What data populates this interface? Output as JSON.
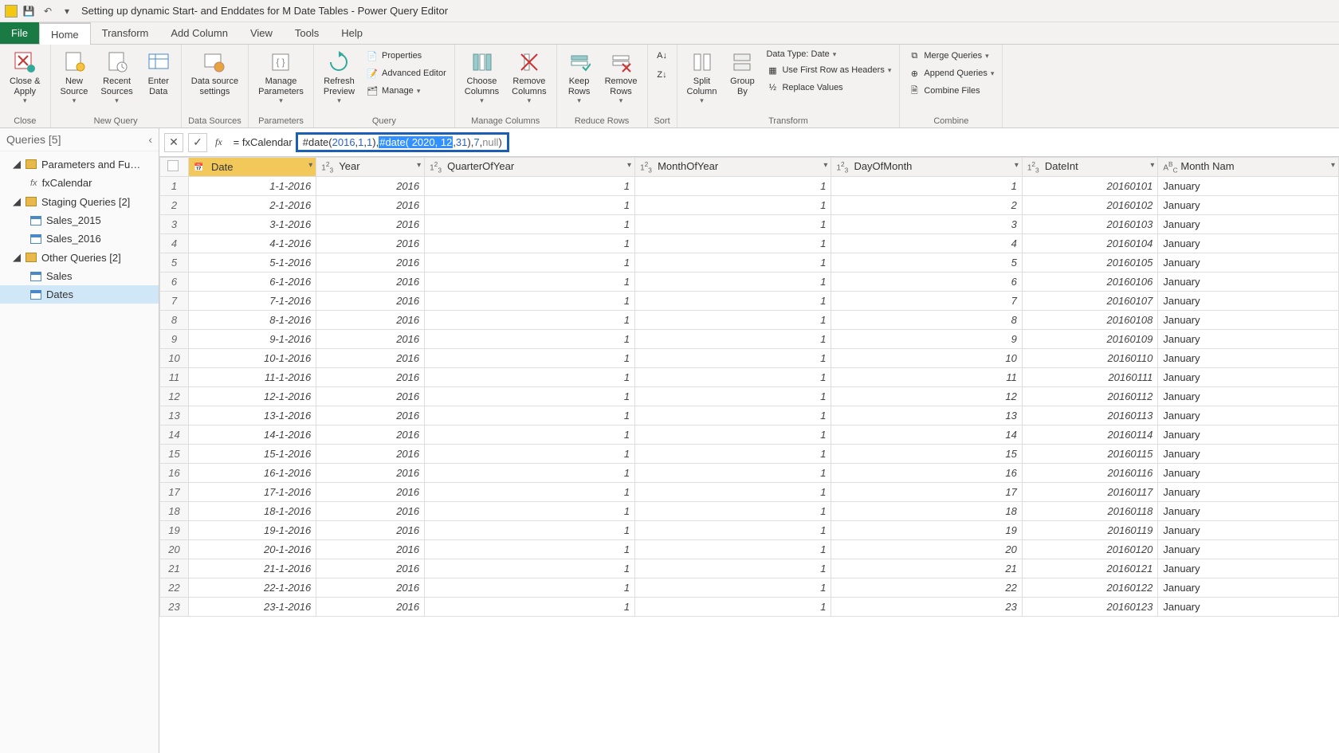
{
  "window": {
    "title": "Setting up dynamic Start- and Enddates for M Date Tables - Power Query Editor"
  },
  "tabs": {
    "file": "File",
    "home": "Home",
    "transform": "Transform",
    "add_column": "Add Column",
    "view": "View",
    "tools": "Tools",
    "help": "Help"
  },
  "ribbon": {
    "close_apply": "Close &\nApply",
    "close_group": "Close",
    "new_source": "New\nSource",
    "recent_sources": "Recent\nSources",
    "enter_data": "Enter\nData",
    "new_query_group": "New Query",
    "data_source_settings": "Data source\nsettings",
    "data_sources_group": "Data Sources",
    "manage_parameters": "Manage\nParameters",
    "parameters_group": "Parameters",
    "refresh_preview": "Refresh\nPreview",
    "properties": "Properties",
    "advanced_editor": "Advanced Editor",
    "manage": "Manage",
    "query_group": "Query",
    "choose_columns": "Choose\nColumns",
    "remove_columns": "Remove\nColumns",
    "manage_columns_group": "Manage Columns",
    "keep_rows": "Keep\nRows",
    "remove_rows": "Remove\nRows",
    "reduce_rows_group": "Reduce Rows",
    "sort_group": "Sort",
    "split_column": "Split\nColumn",
    "group_by": "Group\nBy",
    "data_type": "Data Type: Date",
    "use_first_row": "Use First Row as Headers",
    "replace_values": "Replace Values",
    "transform_group": "Transform",
    "merge_queries": "Merge Queries",
    "append_queries": "Append Queries",
    "combine_files": "Combine Files",
    "combine_group": "Combine"
  },
  "queries": {
    "header": "Queries [5]",
    "groups": [
      {
        "label": "Parameters and Fu…",
        "items": [
          {
            "type": "fx",
            "label": "fxCalendar"
          }
        ]
      },
      {
        "label": "Staging Queries [2]",
        "items": [
          {
            "type": "tbl",
            "label": "Sales_2015"
          },
          {
            "type": "tbl",
            "label": "Sales_2016"
          }
        ]
      },
      {
        "label": "Other Queries [2]",
        "items": [
          {
            "type": "tbl",
            "label": "Sales"
          },
          {
            "type": "tbl",
            "label": "Dates",
            "selected": true
          }
        ]
      }
    ]
  },
  "formula": {
    "prefix": "= fxCalendar",
    "segments": [
      {
        "t": "txt",
        "v": "#date( "
      },
      {
        "t": "num",
        "v": "2016"
      },
      {
        "t": "txt",
        "v": ", "
      },
      {
        "t": "num",
        "v": "1"
      },
      {
        "t": "txt",
        "v": ", "
      },
      {
        "t": "num",
        "v": "1"
      },
      {
        "t": "txt",
        "v": "), "
      },
      {
        "t": "sel",
        "v": "#date( 2020, 12"
      },
      {
        "t": "txt",
        "v": ", "
      },
      {
        "t": "num",
        "v": "31"
      },
      {
        "t": "txt",
        "v": "), "
      },
      {
        "t": "num",
        "v": "7"
      },
      {
        "t": "txt",
        "v": ", "
      },
      {
        "t": "null",
        "v": "null"
      },
      {
        "t": "txt",
        "v": ")"
      }
    ]
  },
  "columns": [
    {
      "name": "Date",
      "type": "date",
      "selected": true
    },
    {
      "name": "Year",
      "type": "num"
    },
    {
      "name": "QuarterOfYear",
      "type": "num"
    },
    {
      "name": "MonthOfYear",
      "type": "num"
    },
    {
      "name": "DayOfMonth",
      "type": "num"
    },
    {
      "name": "DateInt",
      "type": "num"
    },
    {
      "name": "Month Nam",
      "type": "text"
    }
  ],
  "rows": [
    {
      "n": 1,
      "Date": "1-1-2016",
      "Year": "2016",
      "QuarterOfYear": "1",
      "MonthOfYear": "1",
      "DayOfMonth": "1",
      "DateInt": "20160101",
      "Month Nam": "January"
    },
    {
      "n": 2,
      "Date": "2-1-2016",
      "Year": "2016",
      "QuarterOfYear": "1",
      "MonthOfYear": "1",
      "DayOfMonth": "2",
      "DateInt": "20160102",
      "Month Nam": "January"
    },
    {
      "n": 3,
      "Date": "3-1-2016",
      "Year": "2016",
      "QuarterOfYear": "1",
      "MonthOfYear": "1",
      "DayOfMonth": "3",
      "DateInt": "20160103",
      "Month Nam": "January"
    },
    {
      "n": 4,
      "Date": "4-1-2016",
      "Year": "2016",
      "QuarterOfYear": "1",
      "MonthOfYear": "1",
      "DayOfMonth": "4",
      "DateInt": "20160104",
      "Month Nam": "January"
    },
    {
      "n": 5,
      "Date": "5-1-2016",
      "Year": "2016",
      "QuarterOfYear": "1",
      "MonthOfYear": "1",
      "DayOfMonth": "5",
      "DateInt": "20160105",
      "Month Nam": "January"
    },
    {
      "n": 6,
      "Date": "6-1-2016",
      "Year": "2016",
      "QuarterOfYear": "1",
      "MonthOfYear": "1",
      "DayOfMonth": "6",
      "DateInt": "20160106",
      "Month Nam": "January"
    },
    {
      "n": 7,
      "Date": "7-1-2016",
      "Year": "2016",
      "QuarterOfYear": "1",
      "MonthOfYear": "1",
      "DayOfMonth": "7",
      "DateInt": "20160107",
      "Month Nam": "January"
    },
    {
      "n": 8,
      "Date": "8-1-2016",
      "Year": "2016",
      "QuarterOfYear": "1",
      "MonthOfYear": "1",
      "DayOfMonth": "8",
      "DateInt": "20160108",
      "Month Nam": "January"
    },
    {
      "n": 9,
      "Date": "9-1-2016",
      "Year": "2016",
      "QuarterOfYear": "1",
      "MonthOfYear": "1",
      "DayOfMonth": "9",
      "DateInt": "20160109",
      "Month Nam": "January"
    },
    {
      "n": 10,
      "Date": "10-1-2016",
      "Year": "2016",
      "QuarterOfYear": "1",
      "MonthOfYear": "1",
      "DayOfMonth": "10",
      "DateInt": "20160110",
      "Month Nam": "January"
    },
    {
      "n": 11,
      "Date": "11-1-2016",
      "Year": "2016",
      "QuarterOfYear": "1",
      "MonthOfYear": "1",
      "DayOfMonth": "11",
      "DateInt": "20160111",
      "Month Nam": "January"
    },
    {
      "n": 12,
      "Date": "12-1-2016",
      "Year": "2016",
      "QuarterOfYear": "1",
      "MonthOfYear": "1",
      "DayOfMonth": "12",
      "DateInt": "20160112",
      "Month Nam": "January"
    },
    {
      "n": 13,
      "Date": "13-1-2016",
      "Year": "2016",
      "QuarterOfYear": "1",
      "MonthOfYear": "1",
      "DayOfMonth": "13",
      "DateInt": "20160113",
      "Month Nam": "January"
    },
    {
      "n": 14,
      "Date": "14-1-2016",
      "Year": "2016",
      "QuarterOfYear": "1",
      "MonthOfYear": "1",
      "DayOfMonth": "14",
      "DateInt": "20160114",
      "Month Nam": "January"
    },
    {
      "n": 15,
      "Date": "15-1-2016",
      "Year": "2016",
      "QuarterOfYear": "1",
      "MonthOfYear": "1",
      "DayOfMonth": "15",
      "DateInt": "20160115",
      "Month Nam": "January"
    },
    {
      "n": 16,
      "Date": "16-1-2016",
      "Year": "2016",
      "QuarterOfYear": "1",
      "MonthOfYear": "1",
      "DayOfMonth": "16",
      "DateInt": "20160116",
      "Month Nam": "January"
    },
    {
      "n": 17,
      "Date": "17-1-2016",
      "Year": "2016",
      "QuarterOfYear": "1",
      "MonthOfYear": "1",
      "DayOfMonth": "17",
      "DateInt": "20160117",
      "Month Nam": "January"
    },
    {
      "n": 18,
      "Date": "18-1-2016",
      "Year": "2016",
      "QuarterOfYear": "1",
      "MonthOfYear": "1",
      "DayOfMonth": "18",
      "DateInt": "20160118",
      "Month Nam": "January"
    },
    {
      "n": 19,
      "Date": "19-1-2016",
      "Year": "2016",
      "QuarterOfYear": "1",
      "MonthOfYear": "1",
      "DayOfMonth": "19",
      "DateInt": "20160119",
      "Month Nam": "January"
    },
    {
      "n": 20,
      "Date": "20-1-2016",
      "Year": "2016",
      "QuarterOfYear": "1",
      "MonthOfYear": "1",
      "DayOfMonth": "20",
      "DateInt": "20160120",
      "Month Nam": "January"
    },
    {
      "n": 21,
      "Date": "21-1-2016",
      "Year": "2016",
      "QuarterOfYear": "1",
      "MonthOfYear": "1",
      "DayOfMonth": "21",
      "DateInt": "20160121",
      "Month Nam": "January"
    },
    {
      "n": 22,
      "Date": "22-1-2016",
      "Year": "2016",
      "QuarterOfYear": "1",
      "MonthOfYear": "1",
      "DayOfMonth": "22",
      "DateInt": "20160122",
      "Month Nam": "January"
    },
    {
      "n": 23,
      "Date": "23-1-2016",
      "Year": "2016",
      "QuarterOfYear": "1",
      "MonthOfYear": "1",
      "DayOfMonth": "23",
      "DateInt": "20160123",
      "Month Nam": "January"
    }
  ]
}
